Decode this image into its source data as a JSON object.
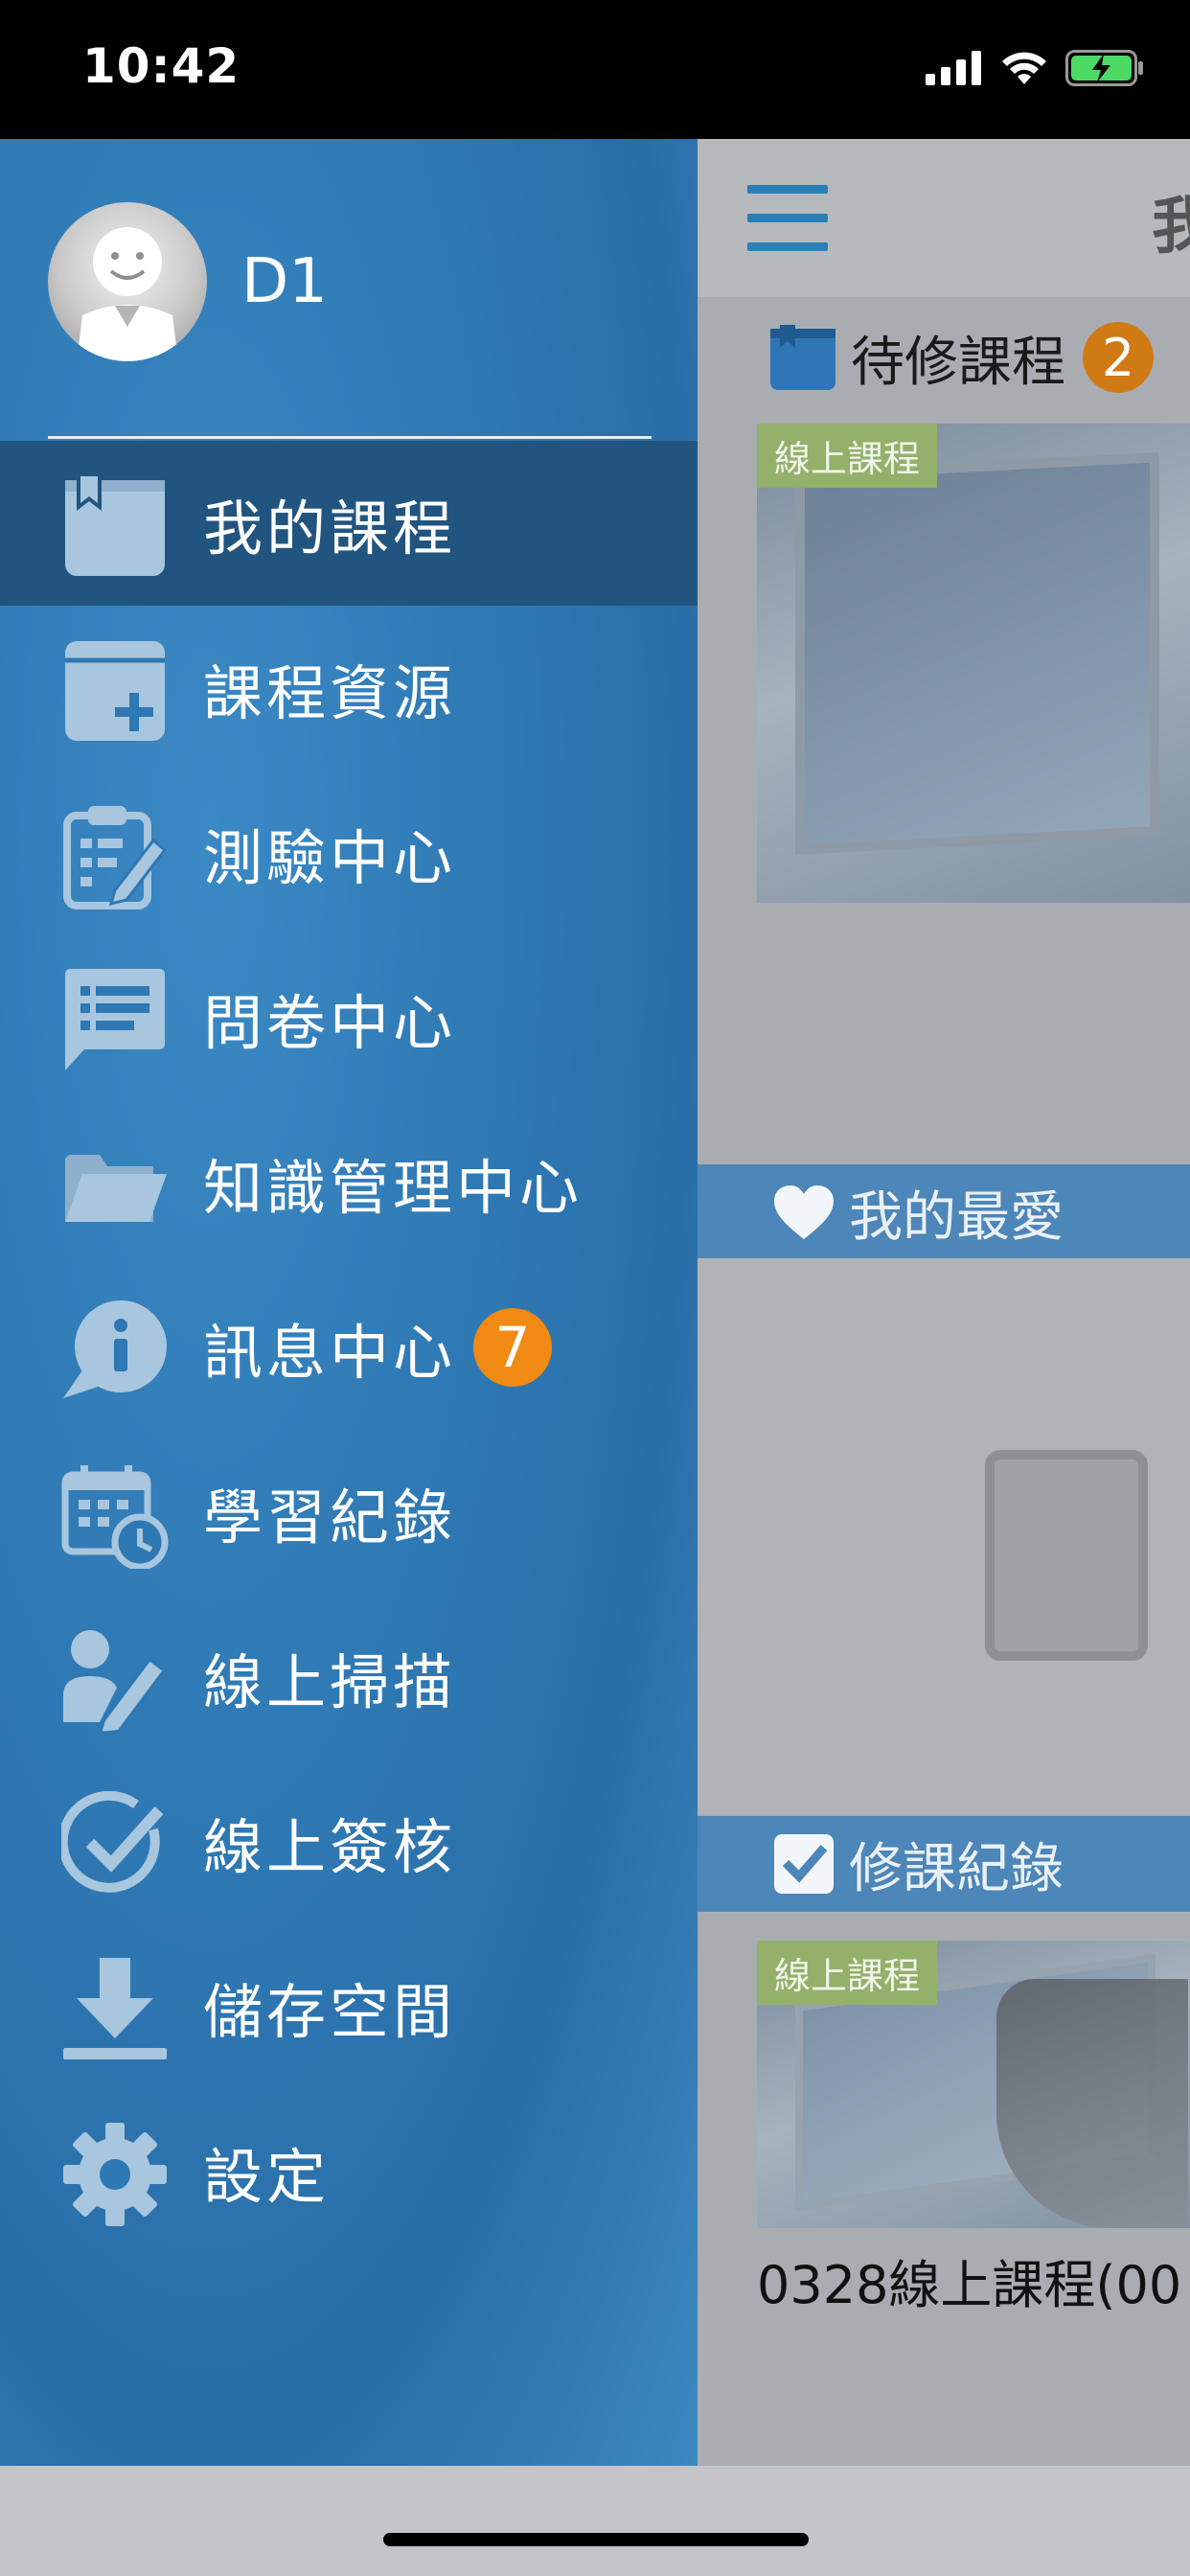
{
  "status_bar": {
    "time": "10:42"
  },
  "drawer": {
    "user": {
      "name": "D1"
    },
    "menu": [
      {
        "label": "我的課程",
        "icon": "book-icon"
      },
      {
        "label": "課程資源",
        "icon": "folder-add-icon"
      },
      {
        "label": "測驗中心",
        "icon": "clipboard-edit-icon"
      },
      {
        "label": "問卷中心",
        "icon": "chat-list-icon"
      },
      {
        "label": "知識管理中心",
        "icon": "open-folder-icon"
      },
      {
        "label": "訊息中心",
        "icon": "info-bubble-icon",
        "badge": "7"
      },
      {
        "label": "學習紀錄",
        "icon": "calendar-clock-icon"
      },
      {
        "label": "線上掃描",
        "icon": "user-pen-icon"
      },
      {
        "label": "線上簽核",
        "icon": "check-circle-icon"
      },
      {
        "label": "儲存空間",
        "icon": "download-icon"
      },
      {
        "label": "設定",
        "icon": "gear-icon"
      }
    ]
  },
  "background_page": {
    "title_fragment": "我",
    "pending_section": {
      "label": "待修課程",
      "count": "2"
    },
    "pending_card": {
      "tag": "線上課程"
    },
    "favorites_section": {
      "label": "我的最愛"
    },
    "records_section": {
      "label": "修課紀錄"
    },
    "record_card": {
      "tag": "線上課程",
      "title": "0328線上課程(00"
    }
  },
  "colors": {
    "drawer_bg": "#2e78b3",
    "active_item_bg": "#21557f",
    "badge_orange": "#f08a12",
    "tag_green": "#94b06a",
    "section_blue": "#4d86b8"
  }
}
